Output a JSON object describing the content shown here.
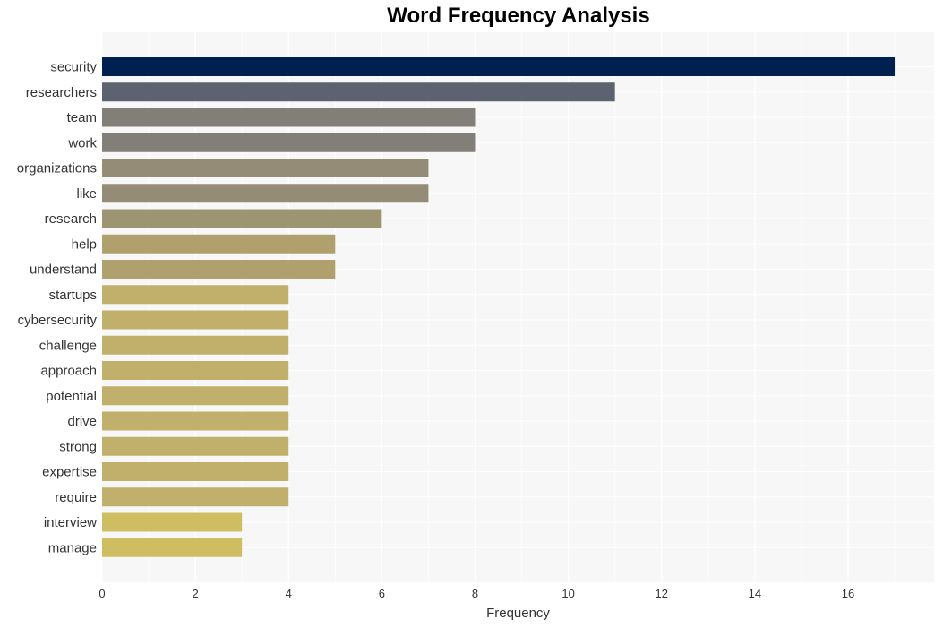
{
  "chart_data": {
    "type": "bar",
    "orientation": "horizontal",
    "title": "Word Frequency Analysis",
    "xlabel": "Frequency",
    "ylabel": "",
    "xlim": [
      0,
      17.8
    ],
    "xticks": [
      0,
      2,
      4,
      6,
      8,
      10,
      12,
      14,
      16
    ],
    "grid": true,
    "categories": [
      "security",
      "researchers",
      "team",
      "work",
      "organizations",
      "like",
      "research",
      "help",
      "understand",
      "startups",
      "cybersecurity",
      "challenge",
      "approach",
      "potential",
      "drive",
      "strong",
      "expertise",
      "require",
      "interview",
      "manage"
    ],
    "values": [
      17,
      11,
      8,
      8,
      7,
      7,
      6,
      5,
      5,
      4,
      4,
      4,
      4,
      4,
      4,
      4,
      4,
      4,
      3,
      3
    ],
    "colors": [
      "#00204f",
      "#5c6270",
      "#827f78",
      "#827f78",
      "#958c78",
      "#958c78",
      "#9d9572",
      "#afa06e",
      "#afa06e",
      "#c0b06b",
      "#c0b06b",
      "#c0b06b",
      "#c0b06b",
      "#c0b06b",
      "#c0b06b",
      "#c0b06b",
      "#c0b06b",
      "#c0b06b",
      "#cfbd62",
      "#cfbd62"
    ]
  }
}
